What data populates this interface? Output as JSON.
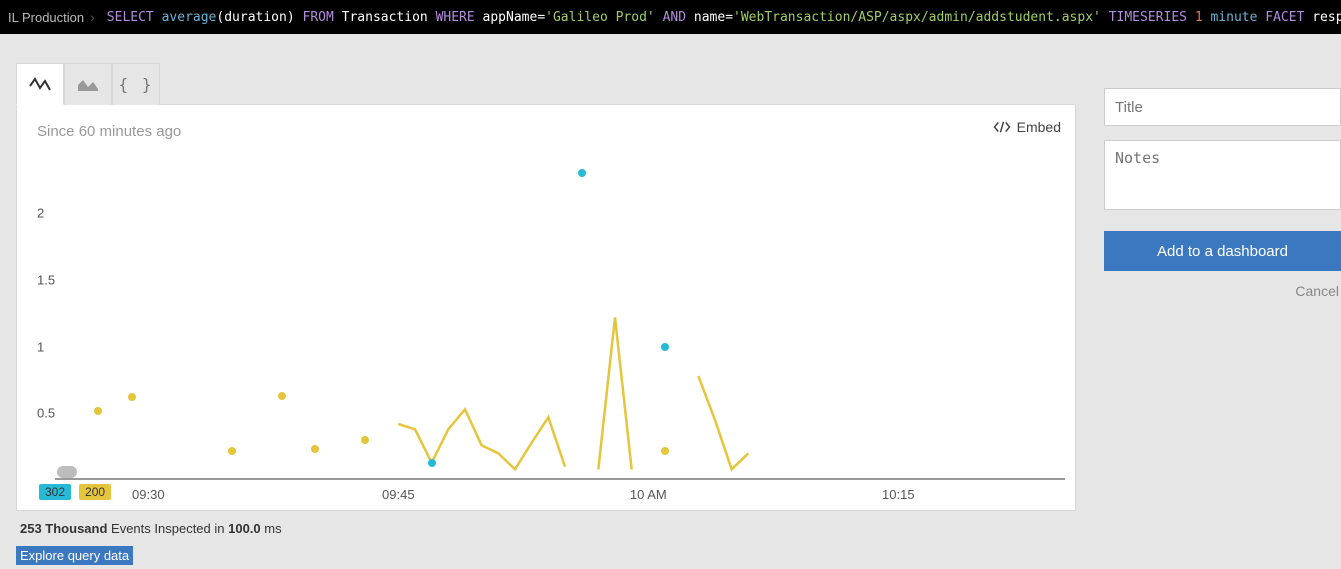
{
  "query_bar": {
    "app_name": "IL Production",
    "tokens": {
      "select": "SELECT",
      "avg": "average",
      "p1": "(",
      "dur": "duration",
      "p2": ")",
      "from": "FROM",
      "txn": "Transaction",
      "where": "WHERE",
      "appNameF": "appName",
      "eq1": " = ",
      "appVal": "'Galileo Prod'",
      "and": "AND",
      "nameF": "name",
      "eq2": " = ",
      "nameVal": "'WebTransaction/ASP/aspx/admin/addstudent.aspx'",
      "ts": "TIMESERIES",
      "one": "1",
      "minute": "minute",
      "facet": "FACET",
      "rstatus": "response.status"
    }
  },
  "tabs": {
    "line": "line",
    "area": "area",
    "json": "{ }"
  },
  "embed_label": "Embed",
  "since_label": "Since 60 minutes ago",
  "chart_data": {
    "type": "line",
    "xlabel": "",
    "ylabel": "",
    "ylim": [
      0,
      2.4
    ],
    "y_ticks": [
      0.5,
      1,
      1.5,
      2
    ],
    "x_range_minutes": [
      0,
      60
    ],
    "x_ticks": [
      {
        "min": 5,
        "label": "09:30"
      },
      {
        "min": 20,
        "label": "09:45"
      },
      {
        "min": 35,
        "label": "10 AM"
      },
      {
        "min": 50,
        "label": "10:15"
      }
    ],
    "series": [
      {
        "name": "200",
        "color": "#e5c53c",
        "segments": [
          [
            [
              2,
              0.52
            ]
          ],
          [
            [
              4,
              0.62
            ]
          ],
          [
            [
              10,
              0.22
            ]
          ],
          [
            [
              13,
              0.63
            ]
          ],
          [
            [
              15,
              0.23
            ]
          ],
          [
            [
              18,
              0.3
            ]
          ],
          [
            [
              20,
              0.42
            ],
            [
              21,
              0.38
            ],
            [
              22,
              0.13
            ],
            [
              23,
              0.38
            ],
            [
              24,
              0.53
            ],
            [
              25,
              0.26
            ],
            [
              26,
              0.2
            ],
            [
              27,
              0.08
            ],
            [
              28,
              0.28
            ],
            [
              29,
              0.47
            ],
            [
              30,
              0.1
            ]
          ],
          [
            [
              32,
              0.08
            ],
            [
              33,
              1.22
            ],
            [
              34,
              0.08
            ]
          ],
          [
            [
              36,
              0.22
            ]
          ],
          [
            [
              38,
              0.78
            ],
            [
              39,
              0.45
            ],
            [
              40,
              0.08
            ],
            [
              41,
              0.2
            ]
          ]
        ]
      },
      {
        "name": "302",
        "color": "#27bad8",
        "segments": [
          [
            [
              22,
              0.13
            ]
          ],
          [
            [
              31,
              2.3
            ]
          ],
          [
            [
              36,
              1.0
            ]
          ]
        ]
      }
    ]
  },
  "legend": {
    "s302": "302",
    "s200": "200"
  },
  "footer": {
    "count": "253 Thousand",
    "mid": " Events Inspected in ",
    "time": "100.0",
    "unit": " ms"
  },
  "explore": "Explore query data",
  "sidebar": {
    "title_placeholder": "Title",
    "notes_placeholder": "Notes",
    "add_label": "Add to a dashboard",
    "cancel_label": "Cancel"
  }
}
